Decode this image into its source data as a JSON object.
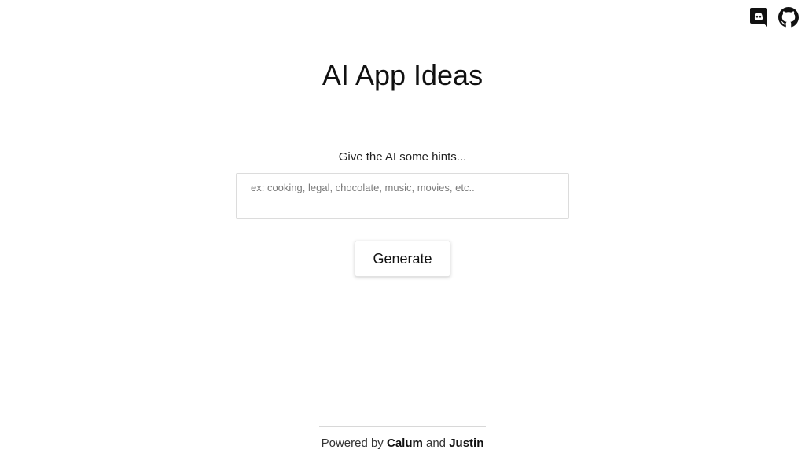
{
  "header": {
    "title": "AI App Ideas",
    "icons": [
      {
        "name": "discord-icon",
        "color": "#111111"
      },
      {
        "name": "github-icon",
        "color": "#111111"
      }
    ]
  },
  "form": {
    "label": "Give the AI some hints...",
    "input_placeholder": "ex: cooking, legal, chocolate, music, movies, etc..",
    "input_value": "",
    "generate_label": "Generate"
  },
  "footer": {
    "prefix": "Powered by",
    "author1": "Calum",
    "conjunction": "and",
    "author2": "Justin"
  }
}
